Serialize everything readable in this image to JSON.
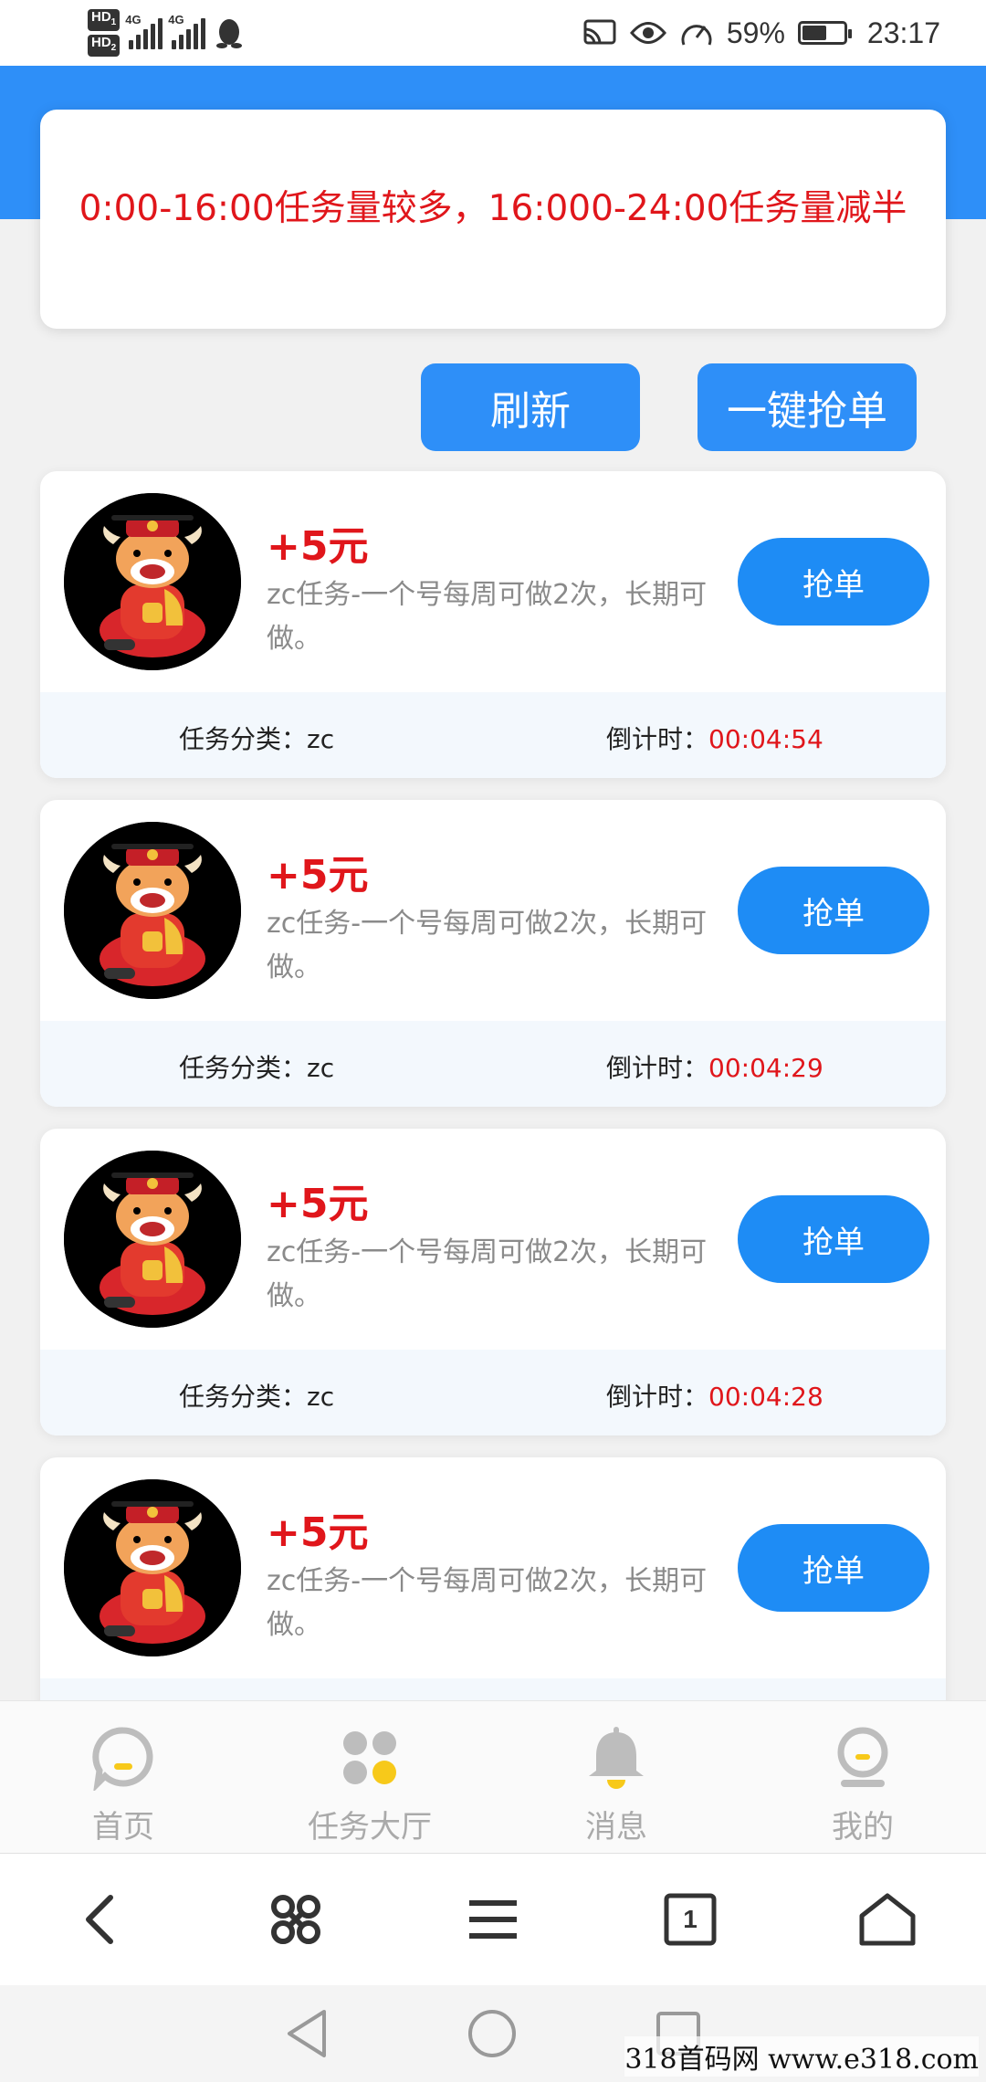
{
  "status_bar": {
    "hd1": "HD",
    "hd1_sub": "1",
    "hd2": "HD",
    "hd2_sub": "2",
    "net1": "4G",
    "net2": "4G",
    "battery_percent": "59%",
    "battery_level": 0.59,
    "time": "23:17",
    "icons": [
      "cast-icon",
      "eye-icon",
      "speed-icon",
      "qq-penguin-icon"
    ]
  },
  "notice": {
    "text": "0:00-16:00任务量较多，16:000-24:00任务量减半"
  },
  "actions": {
    "refresh_label": "刷新",
    "grab_all_label": "一键抢单"
  },
  "tasks": [
    {
      "reward": "+5元",
      "desc": "zc任务-一个号每周可做2次，长期可做。",
      "button": "抢单",
      "category_label": "任务分类：",
      "category": "zc",
      "countdown_label": "倒计时：",
      "countdown": "00:04:54"
    },
    {
      "reward": "+5元",
      "desc": "zc任务-一个号每周可做2次，长期可做。",
      "button": "抢单",
      "category_label": "任务分类：",
      "category": "zc",
      "countdown_label": "倒计时：",
      "countdown": "00:04:29"
    },
    {
      "reward": "+5元",
      "desc": "zc任务-一个号每周可做2次，长期可做。",
      "button": "抢单",
      "category_label": "任务分类：",
      "category": "zc",
      "countdown_label": "倒计时：",
      "countdown": "00:04:28"
    },
    {
      "reward": "+5元",
      "desc": "zc任务-一个号每周可做2次，长期可做。",
      "button": "抢单",
      "category_label": "",
      "category": "",
      "countdown_label": "",
      "countdown": ""
    }
  ],
  "tabbar": {
    "items": [
      {
        "label": "首页",
        "icon": "home-chat-icon"
      },
      {
        "label": "任务大厅",
        "icon": "task-hall-icon"
      },
      {
        "label": "消息",
        "icon": "bell-icon"
      },
      {
        "label": "我的",
        "icon": "profile-icon"
      }
    ]
  },
  "browser_bar": {
    "tab_count": "1",
    "icons": [
      "back-icon",
      "command-icon",
      "menu-icon",
      "tabs-icon",
      "home-icon"
    ]
  },
  "watermark": "318首码网  www.e318.com",
  "colors": {
    "accent": "#2e8ff8",
    "grab_button": "#1e8cf5",
    "highlight": "#e0161b",
    "tab_icon_gray": "#bdbdbd",
    "tab_icon_yellow": "#f7c91a"
  }
}
